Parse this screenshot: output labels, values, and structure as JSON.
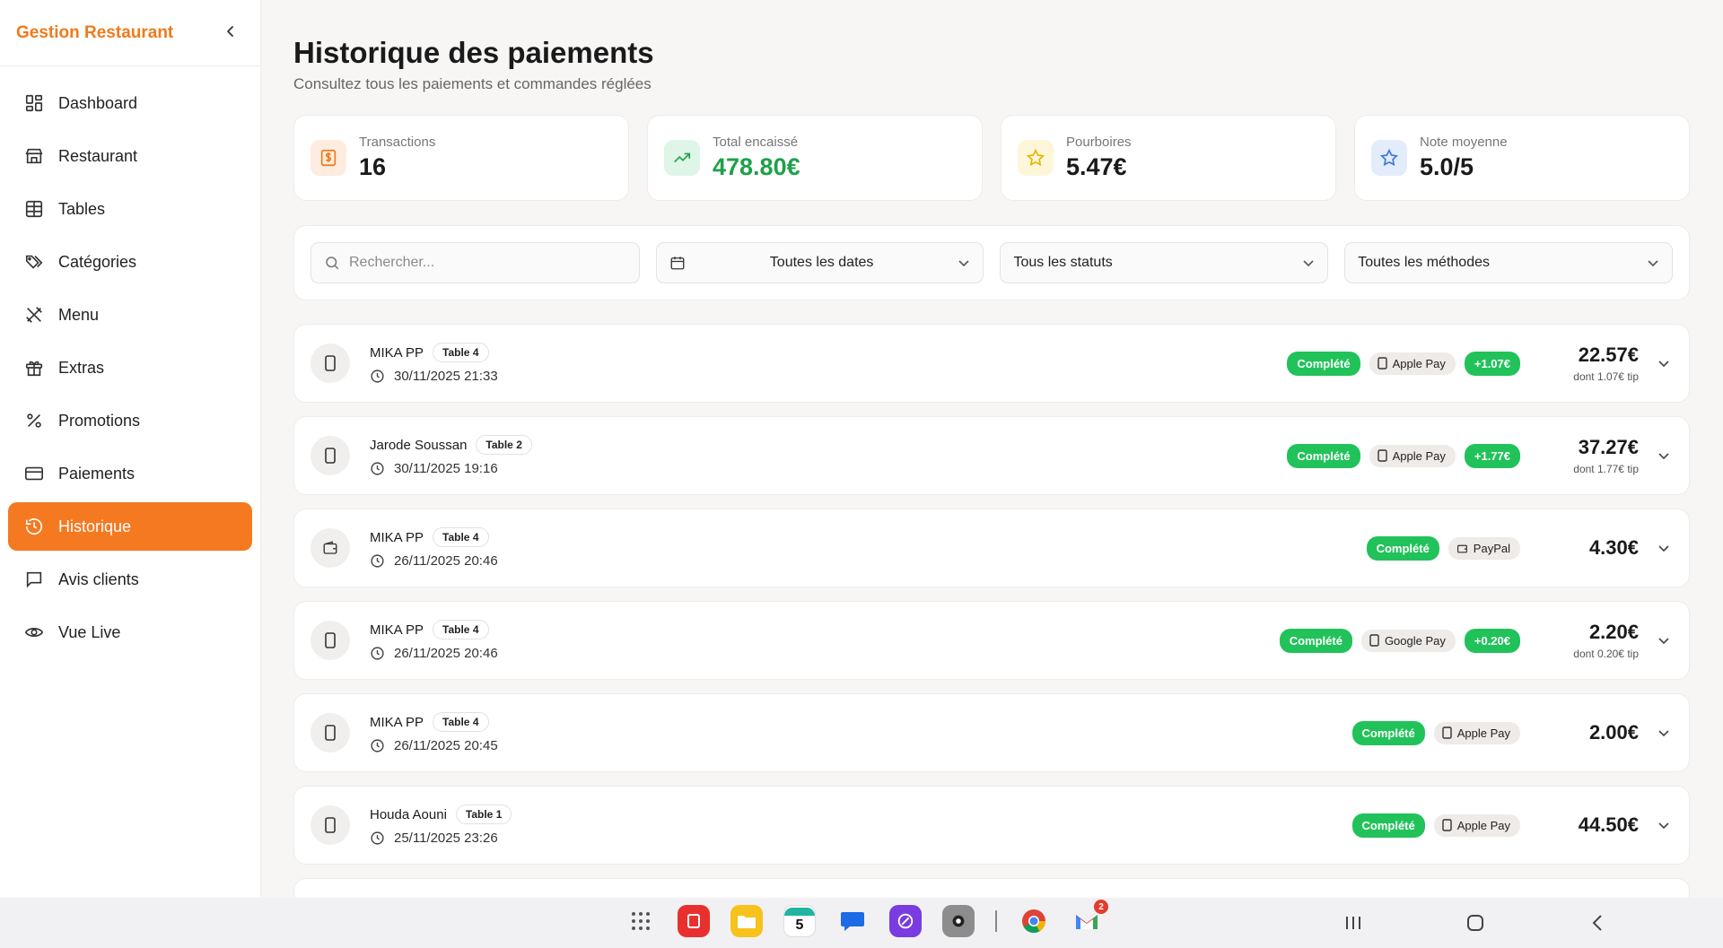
{
  "sidebar": {
    "brand": "Gestion Restaurant",
    "items": [
      {
        "label": "Dashboard",
        "icon": "dashboard-icon"
      },
      {
        "label": "Restaurant",
        "icon": "store-icon"
      },
      {
        "label": "Tables",
        "icon": "table-grid-icon"
      },
      {
        "label": "Catégories",
        "icon": "tags-icon"
      },
      {
        "label": "Menu",
        "icon": "utensils-icon"
      },
      {
        "label": "Extras",
        "icon": "gift-icon"
      },
      {
        "label": "Promotions",
        "icon": "percent-icon"
      },
      {
        "label": "Paiements",
        "icon": "credit-card-icon"
      },
      {
        "label": "Historique",
        "icon": "history-icon",
        "active": true
      },
      {
        "label": "Avis clients",
        "icon": "message-icon"
      },
      {
        "label": "Vue Live",
        "icon": "eye-icon"
      }
    ]
  },
  "header": {
    "title": "Historique des paiements",
    "subtitle": "Consultez tous les paiements et commandes réglées"
  },
  "stats": [
    {
      "label": "Transactions",
      "value": "16"
    },
    {
      "label": "Total encaissé",
      "value": "478.80€"
    },
    {
      "label": "Pourboires",
      "value": "5.47€"
    },
    {
      "label": "Note moyenne",
      "value": "5.0/5"
    }
  ],
  "filters": {
    "search_placeholder": "Rechercher...",
    "dates": "Toutes les dates",
    "statuses": "Tous les statuts",
    "methods": "Toutes les méthodes"
  },
  "payments": [
    {
      "name": "MIKA PP",
      "table": "Table 4",
      "datetime": "30/11/2025 21:33",
      "status": "Complété",
      "method": "Apple Pay",
      "tip": "+1.07€",
      "amount": "22.57€",
      "tip_note": "dont 1.07€ tip"
    },
    {
      "name": "Jarode Soussan",
      "table": "Table 2",
      "datetime": "30/11/2025 19:16",
      "status": "Complété",
      "method": "Apple Pay",
      "tip": "+1.77€",
      "amount": "37.27€",
      "tip_note": "dont 1.77€ tip"
    },
    {
      "name": "MIKA PP",
      "table": "Table 4",
      "datetime": "26/11/2025 20:46",
      "status": "Complété",
      "method": "PayPal",
      "tip": "",
      "amount": "4.30€",
      "tip_note": ""
    },
    {
      "name": "MIKA PP",
      "table": "Table 4",
      "datetime": "26/11/2025 20:46",
      "status": "Complété",
      "method": "Google Pay",
      "tip": "+0.20€",
      "amount": "2.20€",
      "tip_note": "dont 0.20€ tip"
    },
    {
      "name": "MIKA PP",
      "table": "Table 4",
      "datetime": "26/11/2025 20:45",
      "status": "Complété",
      "method": "Apple Pay",
      "tip": "",
      "amount": "2.00€",
      "tip_note": ""
    },
    {
      "name": "Houda Aouni",
      "table": "Table 1",
      "datetime": "25/11/2025 23:26",
      "status": "Complété",
      "method": "Apple Pay",
      "tip": "",
      "amount": "44.50€",
      "tip_note": ""
    }
  ],
  "taskbar": {
    "calendar_day": "5",
    "gmail_badge": "2"
  },
  "colors": {
    "accent": "#f47920",
    "success": "#22c25a",
    "total_green": "#1fa04a"
  }
}
